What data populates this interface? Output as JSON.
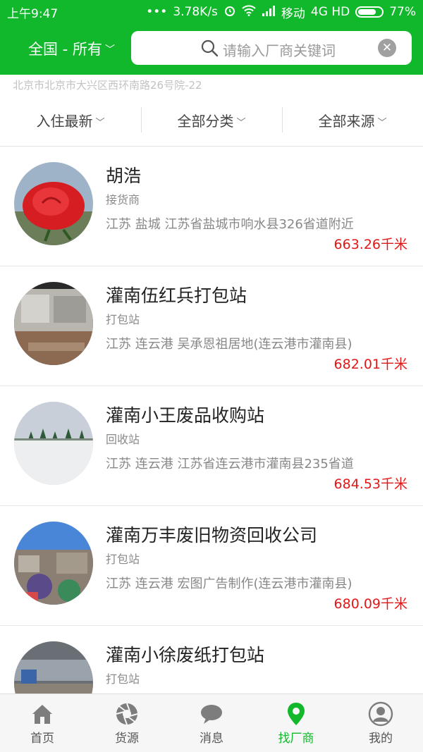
{
  "status_bar": {
    "time": "上午9:47",
    "dots": "•••",
    "speed": "3.78K/s",
    "carrier": "移动",
    "network": "4G HD",
    "battery": "77%",
    "battery_level": 0.77
  },
  "header": {
    "region": "全国 - 所有",
    "search_placeholder": "请输入厂商关键词"
  },
  "address": "北京市北京市大兴区西环南路26号院-22",
  "filters": [
    {
      "label": "入住最新"
    },
    {
      "label": "全部分类"
    },
    {
      "label": "全部来源"
    }
  ],
  "list": [
    {
      "name": "胡浩",
      "type": "接货商",
      "addr": "江苏 盐城 江苏省盐城市响水县326省道附近",
      "dist": "663.26千米"
    },
    {
      "name": "灌南伍红兵打包站",
      "type": "打包站",
      "addr": "江苏 连云港 吴承恩祖居地(连云港市灌南县)",
      "dist": "682.01千米"
    },
    {
      "name": "灌南小王废品收购站",
      "type": "回收站",
      "addr": "江苏 连云港 江苏省连云港市灌南县235省道",
      "dist": "684.53千米"
    },
    {
      "name": "灌南万丰废旧物资回收公司",
      "type": "打包站",
      "addr": "江苏 连云港 宏图广告制作(连云港市灌南县)",
      "dist": "680.09千米"
    },
    {
      "name": "灌南小徐废纸打包站",
      "type": "打包站",
      "addr": "",
      "dist": ""
    }
  ],
  "tabs": [
    {
      "label": "首页",
      "icon": "home-icon"
    },
    {
      "label": "货源",
      "icon": "aperture-icon"
    },
    {
      "label": "消息",
      "icon": "chat-bubble-icon"
    },
    {
      "label": "找厂商",
      "icon": "location-pin-icon"
    },
    {
      "label": "我的",
      "icon": "user-icon"
    }
  ],
  "colors": {
    "brand_green": "#12b82c",
    "distance_red": "#e01818"
  }
}
